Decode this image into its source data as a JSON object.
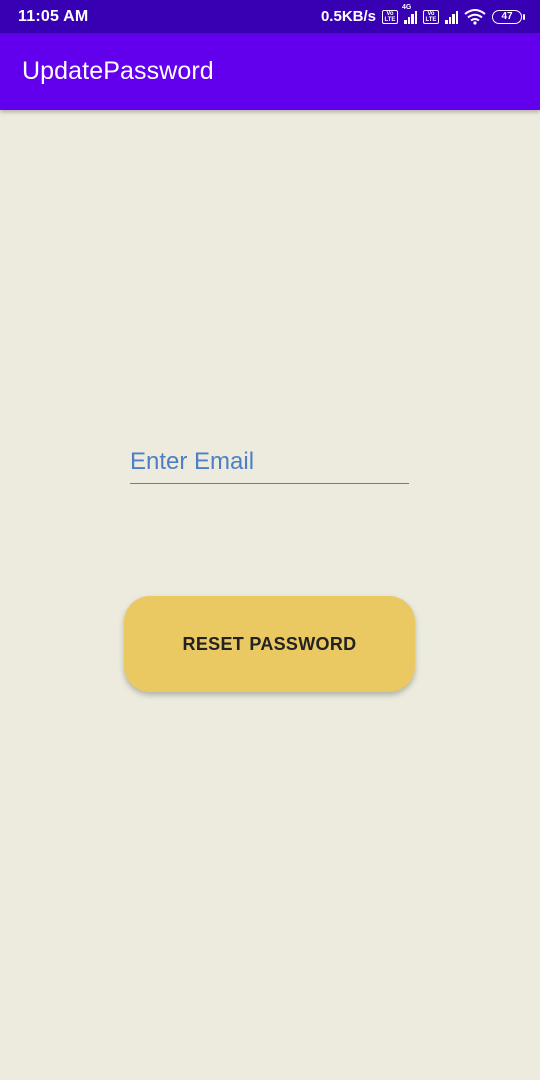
{
  "status_bar": {
    "time": "11:05 AM",
    "net_speed": "0.5KB/s",
    "battery_level": "47",
    "network_type": "4G",
    "volte_label": "Vo LTE",
    "icons": [
      "volte-icon",
      "signal-icon",
      "wifi-icon",
      "battery-icon"
    ]
  },
  "app_bar": {
    "title": "UpdatePassword",
    "color": "#6200ee"
  },
  "form": {
    "email_placeholder": "Enter Email",
    "email_value": "",
    "reset_button_label": "RESET PASSWORD",
    "button_color": "#eac862"
  }
}
